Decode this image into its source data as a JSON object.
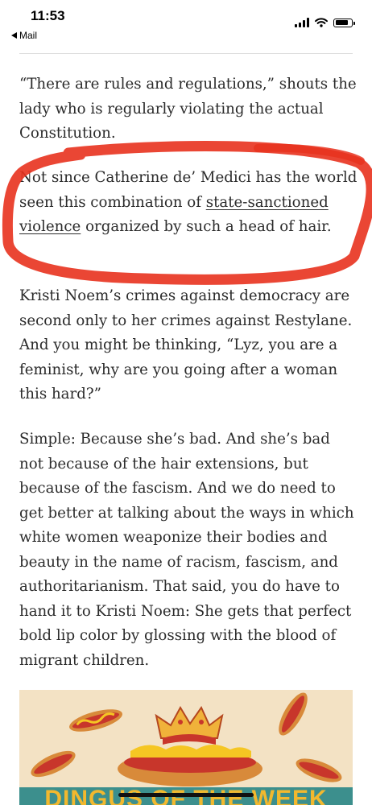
{
  "status_bar": {
    "time": "11:53",
    "back_label": "Mail"
  },
  "article": {
    "paragraphs": [
      "“There are rules and regulations,” shouts the lady who is regularly violating the actual Constitution.",
      null,
      "Kristi Noem’s crimes against democracy are second only to her crimes against Restylane. And you might be thinking, “Lyz, you are a feminist, why are you going after a woman this hard?”",
      "Simple: Because she’s bad. And she’s bad not because of the hair extensions, but because of the fascism. And we do need to get better at talking about the ways in which white women weaponize their bodies and beauty in the name of racism, fascism, and authoritarianism. That said, you do have to hand it to Kristi Noem: She gets that perfect bold lip color by glossing with the blood of migrant children."
    ],
    "highlighted": {
      "before": "Not since Catherine de’ Medici has the world seen this combination of ",
      "link": "state-sanctioned violence",
      "after": " organized by such a head of hair."
    }
  },
  "banner": {
    "title": "DINGUS OF THE WEEK"
  },
  "colors": {
    "annotation": "#e8321e",
    "banner_bg": "#f3e2c4",
    "banner_strip": "#3c8f8d",
    "banner_title": "#f2b82e"
  }
}
